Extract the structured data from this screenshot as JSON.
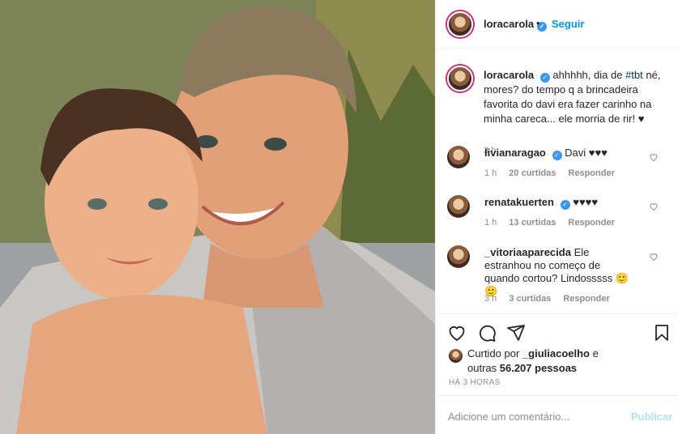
{
  "post": {
    "username": "loracarola",
    "follow_label": "Seguir",
    "dot": "•",
    "caption": {
      "before": "ahhhhh, dia de ",
      "hashtag": "#tbt",
      "after": " né, mores? do tempo q a brincadeira favorita do davi era fazer carinho na minha careca... ele morria de rir! ♥",
      "time": "3 h"
    }
  },
  "comments": [
    {
      "username": "livianaragao",
      "verified": true,
      "text": "Davi ♥♥♥",
      "time": "1 h",
      "likes": "20 curtidas",
      "reply": "Responder"
    },
    {
      "username": "renatakuerten",
      "verified": true,
      "text": "♥♥♥♥",
      "time": "1 h",
      "likes": "13 curtidas",
      "reply": "Responder"
    },
    {
      "username": "_vitoriaaparecida",
      "verified": false,
      "text": "Ele estranhou no começo de quando cortou? Lindosssss 🙂🙂",
      "time": "3 h",
      "likes": "3 curtidas",
      "reply": "Responder"
    }
  ],
  "likes": {
    "prefix": "Curtido por ",
    "user": "_giuliacoelho",
    "middle": " e outras ",
    "count": "56.207 pessoas"
  },
  "posted_ago": "HÁ 3 HORAS",
  "composer": {
    "placeholder": "Adicione um comentário...",
    "post_label": "Publicar"
  },
  "colors": {
    "link": "#0095f6",
    "verified": "#3897f0",
    "muted": "#8e8e8e",
    "post_disabled": "#b2dffc"
  },
  "icons": [
    "heart-icon",
    "comment-icon",
    "share-icon",
    "bookmark-icon",
    "verified-icon",
    "small-heart-icon"
  ]
}
